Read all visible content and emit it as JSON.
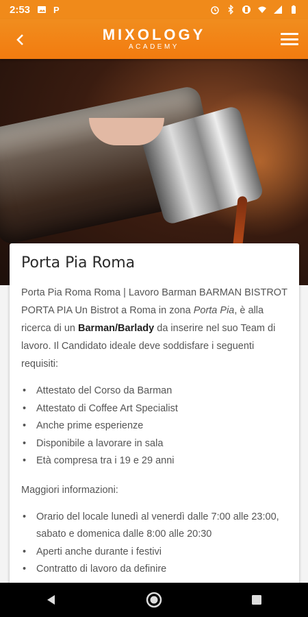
{
  "status": {
    "time": "2:53",
    "icons_left": [
      "image-icon",
      "parking-icon"
    ],
    "icons_right": [
      "alarm-icon",
      "bluetooth-icon",
      "vibrate-icon",
      "wifi-icon",
      "signal-icon",
      "battery-icon"
    ]
  },
  "app_bar": {
    "brand_name": "MIXOLOGY",
    "brand_sub": "ACADEMY",
    "back_icon": "chevron-left-icon",
    "menu_icon": "hamburger-menu-icon"
  },
  "article": {
    "title": "Porta Pia Roma",
    "intro_1": "Porta Pia Roma Roma | Lavoro Barman BARMAN BISTROT PORTA  PIA Un Bistrot a Roma in zona ",
    "intro_italic": "Porta Pia",
    "intro_2": ", è alla ricerca di un ",
    "intro_bold": "Barman/Barlady",
    "intro_3": " da inserire nel suo Team di lavoro. Il Candidato ideale deve soddisfare i seguenti requisiti:",
    "requirements": [
      "Attestato del Corso da Barman",
      "Attestato di Coffee Art Specialist",
      "Anche prime esperienze",
      "Disponibile a lavorare in sala",
      "Età compresa tra i 19 e 29 anni"
    ],
    "more_label": "Maggiori informazioni:",
    "info": [
      "Orario del locale lunedì al venerdì dalle 7:00 alle 23:00, sabato e domenica dalle 8:00 alle 20:30",
      "Aperti anche durante i festivi",
      "Contratto di lavoro da definire"
    ]
  },
  "nav": {
    "back": "back-triangle-icon",
    "home": "home-circle-icon",
    "recents": "recents-square-icon"
  },
  "colors": {
    "accent": "#f08a1a",
    "text": "#555555",
    "title": "#2b2b2b"
  }
}
